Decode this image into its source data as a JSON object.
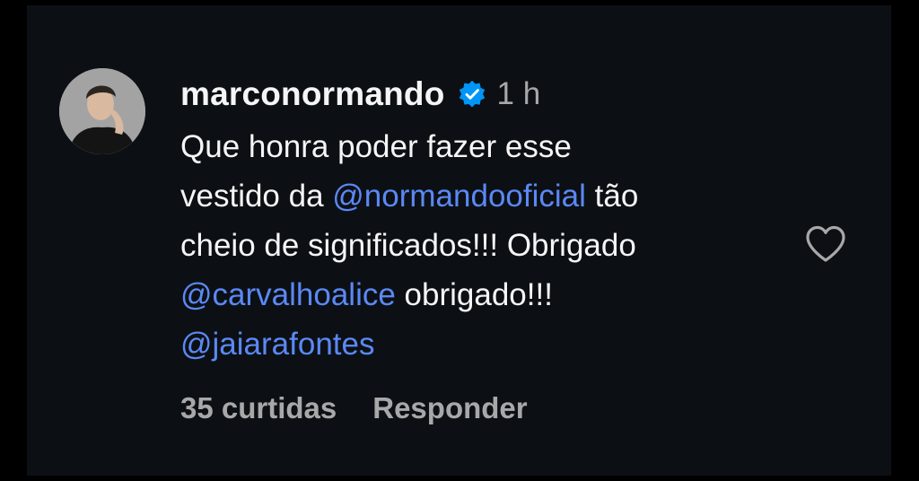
{
  "comment": {
    "username": "marconormando",
    "time": "1 h",
    "line1": "Que honra poder fazer esse",
    "line2_prefix": "vestido da ",
    "mention1": "@normandooficial",
    "line2_suffix": " tão",
    "line3": "cheio de significados!!! Obrigado",
    "mention2": "@carvalhoalice",
    "line4_suffix": " obrigado!!!",
    "mention3": "@jaiarafontes",
    "likes": "35 curtidas",
    "reply": "Responder"
  },
  "icons": {
    "verified": "verified-badge-icon",
    "like": "heart-outline-icon",
    "avatar": "profile-avatar"
  },
  "colors": {
    "background": "#0c1014",
    "text": "#f5f5f5",
    "secondary": "#a8a8a8",
    "mention": "#5b88f5",
    "verified": "#0095f6"
  }
}
